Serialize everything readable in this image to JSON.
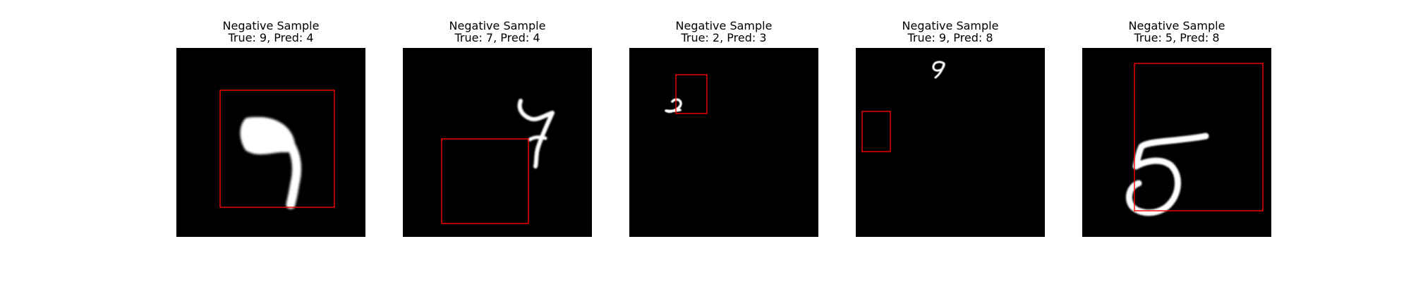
{
  "figure": {
    "background": "#ffffff",
    "image_background": "#000000",
    "box_color": "#ff0000",
    "digit_color": "#ffffff"
  },
  "panels": [
    {
      "title": "Negative Sample",
      "subtitle": "True: 9, Pred: 4",
      "digit": "9"
    },
    {
      "title": "Negative Sample",
      "subtitle": "True: 7, Pred: 4",
      "digit": "7"
    },
    {
      "title": "Negative Sample",
      "subtitle": "True: 2, Pred: 3",
      "digit": "2"
    },
    {
      "title": "Negative Sample",
      "subtitle": "True: 9, Pred: 8",
      "digit": "9"
    },
    {
      "title": "Negative Sample",
      "subtitle": "True: 5, Pred: 8",
      "digit": "5"
    }
  ]
}
